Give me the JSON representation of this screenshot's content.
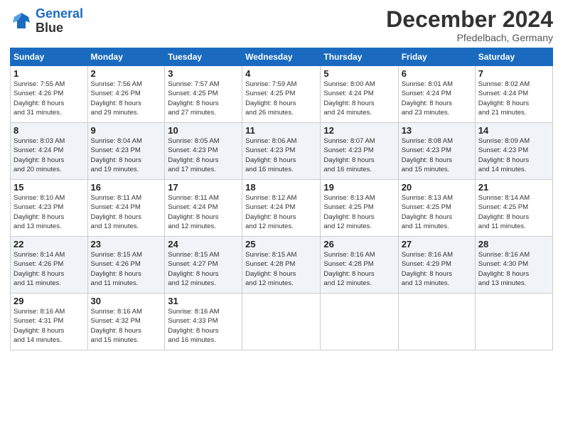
{
  "header": {
    "logo_line1": "General",
    "logo_line2": "Blue",
    "month": "December 2024",
    "location": "Pfedelbach, Germany"
  },
  "weekdays": [
    "Sunday",
    "Monday",
    "Tuesday",
    "Wednesday",
    "Thursday",
    "Friday",
    "Saturday"
  ],
  "weeks": [
    [
      {
        "day": "1",
        "info": "Sunrise: 7:55 AM\nSunset: 4:26 PM\nDaylight: 8 hours\nand 31 minutes."
      },
      {
        "day": "2",
        "info": "Sunrise: 7:56 AM\nSunset: 4:26 PM\nDaylight: 8 hours\nand 29 minutes."
      },
      {
        "day": "3",
        "info": "Sunrise: 7:57 AM\nSunset: 4:25 PM\nDaylight: 8 hours\nand 27 minutes."
      },
      {
        "day": "4",
        "info": "Sunrise: 7:59 AM\nSunset: 4:25 PM\nDaylight: 8 hours\nand 26 minutes."
      },
      {
        "day": "5",
        "info": "Sunrise: 8:00 AM\nSunset: 4:24 PM\nDaylight: 8 hours\nand 24 minutes."
      },
      {
        "day": "6",
        "info": "Sunrise: 8:01 AM\nSunset: 4:24 PM\nDaylight: 8 hours\nand 23 minutes."
      },
      {
        "day": "7",
        "info": "Sunrise: 8:02 AM\nSunset: 4:24 PM\nDaylight: 8 hours\nand 21 minutes."
      }
    ],
    [
      {
        "day": "8",
        "info": "Sunrise: 8:03 AM\nSunset: 4:24 PM\nDaylight: 8 hours\nand 20 minutes."
      },
      {
        "day": "9",
        "info": "Sunrise: 8:04 AM\nSunset: 4:23 PM\nDaylight: 8 hours\nand 19 minutes."
      },
      {
        "day": "10",
        "info": "Sunrise: 8:05 AM\nSunset: 4:23 PM\nDaylight: 8 hours\nand 17 minutes."
      },
      {
        "day": "11",
        "info": "Sunrise: 8:06 AM\nSunset: 4:23 PM\nDaylight: 8 hours\nand 16 minutes."
      },
      {
        "day": "12",
        "info": "Sunrise: 8:07 AM\nSunset: 4:23 PM\nDaylight: 8 hours\nand 16 minutes."
      },
      {
        "day": "13",
        "info": "Sunrise: 8:08 AM\nSunset: 4:23 PM\nDaylight: 8 hours\nand 15 minutes."
      },
      {
        "day": "14",
        "info": "Sunrise: 8:09 AM\nSunset: 4:23 PM\nDaylight: 8 hours\nand 14 minutes."
      }
    ],
    [
      {
        "day": "15",
        "info": "Sunrise: 8:10 AM\nSunset: 4:23 PM\nDaylight: 8 hours\nand 13 minutes."
      },
      {
        "day": "16",
        "info": "Sunrise: 8:11 AM\nSunset: 4:24 PM\nDaylight: 8 hours\nand 13 minutes."
      },
      {
        "day": "17",
        "info": "Sunrise: 8:11 AM\nSunset: 4:24 PM\nDaylight: 8 hours\nand 12 minutes."
      },
      {
        "day": "18",
        "info": "Sunrise: 8:12 AM\nSunset: 4:24 PM\nDaylight: 8 hours\nand 12 minutes."
      },
      {
        "day": "19",
        "info": "Sunrise: 8:13 AM\nSunset: 4:25 PM\nDaylight: 8 hours\nand 12 minutes."
      },
      {
        "day": "20",
        "info": "Sunrise: 8:13 AM\nSunset: 4:25 PM\nDaylight: 8 hours\nand 11 minutes."
      },
      {
        "day": "21",
        "info": "Sunrise: 8:14 AM\nSunset: 4:25 PM\nDaylight: 8 hours\nand 11 minutes."
      }
    ],
    [
      {
        "day": "22",
        "info": "Sunrise: 8:14 AM\nSunset: 4:26 PM\nDaylight: 8 hours\nand 11 minutes."
      },
      {
        "day": "23",
        "info": "Sunrise: 8:15 AM\nSunset: 4:26 PM\nDaylight: 8 hours\nand 11 minutes."
      },
      {
        "day": "24",
        "info": "Sunrise: 8:15 AM\nSunset: 4:27 PM\nDaylight: 8 hours\nand 12 minutes."
      },
      {
        "day": "25",
        "info": "Sunrise: 8:15 AM\nSunset: 4:28 PM\nDaylight: 8 hours\nand 12 minutes."
      },
      {
        "day": "26",
        "info": "Sunrise: 8:16 AM\nSunset: 4:28 PM\nDaylight: 8 hours\nand 12 minutes."
      },
      {
        "day": "27",
        "info": "Sunrise: 8:16 AM\nSunset: 4:29 PM\nDaylight: 8 hours\nand 13 minutes."
      },
      {
        "day": "28",
        "info": "Sunrise: 8:16 AM\nSunset: 4:30 PM\nDaylight: 8 hours\nand 13 minutes."
      }
    ],
    [
      {
        "day": "29",
        "info": "Sunrise: 8:16 AM\nSunset: 4:31 PM\nDaylight: 8 hours\nand 14 minutes."
      },
      {
        "day": "30",
        "info": "Sunrise: 8:16 AM\nSunset: 4:32 PM\nDaylight: 8 hours\nand 15 minutes."
      },
      {
        "day": "31",
        "info": "Sunrise: 8:16 AM\nSunset: 4:33 PM\nDaylight: 8 hours\nand 16 minutes."
      },
      null,
      null,
      null,
      null
    ]
  ]
}
